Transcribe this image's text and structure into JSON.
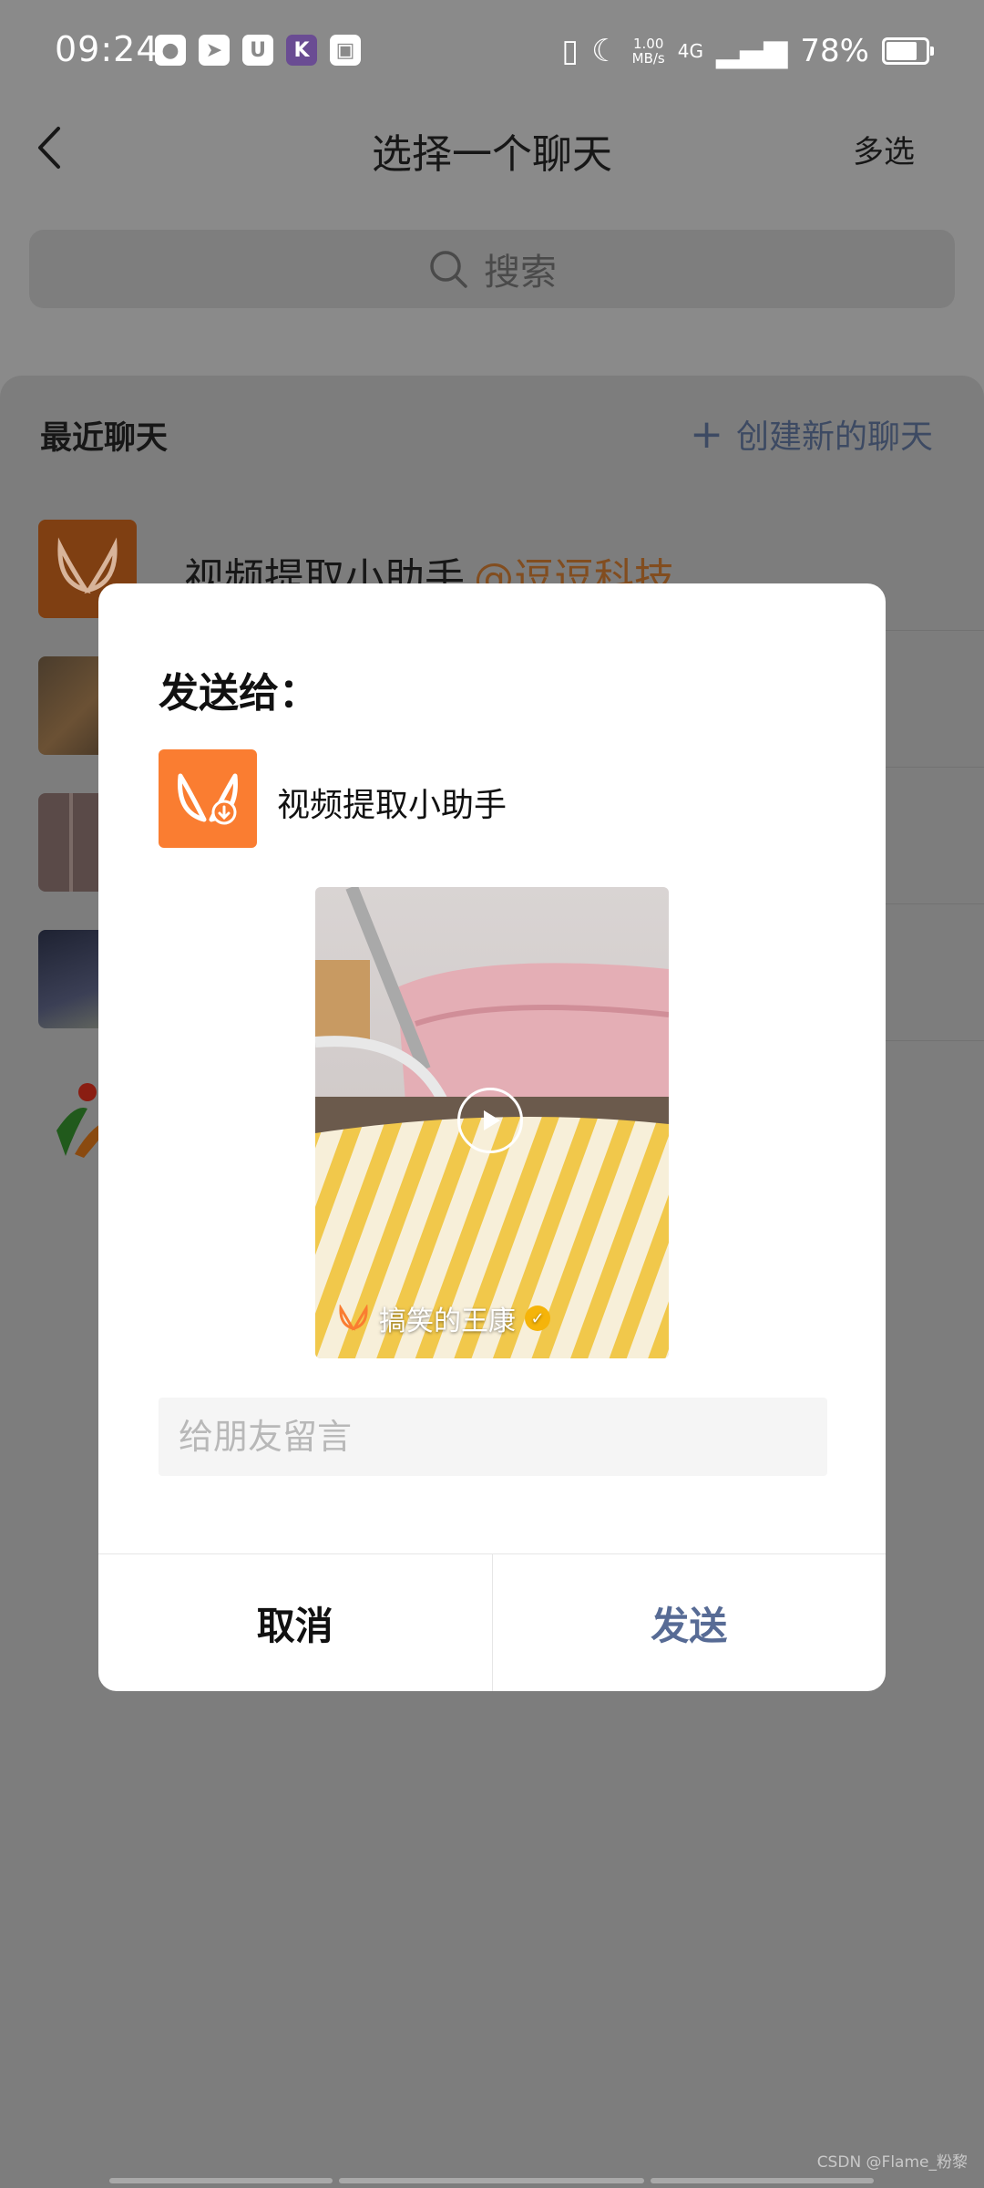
{
  "status_bar": {
    "time": "09:24",
    "app_icons": [
      "wechat-icon",
      "paper-plane-icon",
      "cup-icon",
      "k-icon",
      "inbox-icon"
    ],
    "network_speed_value": "1.00",
    "network_speed_unit": "MB/s",
    "signal_type": "4G",
    "battery": "78%"
  },
  "header": {
    "title": "选择一个聊天",
    "multi_select": "多选"
  },
  "search": {
    "placeholder": "搜索"
  },
  "recent": {
    "title": "最近聊天",
    "new_chat": "创建新的聊天",
    "items": [
      {
        "name": "视频提取小助手",
        "tag": "@逗逗科技"
      }
    ]
  },
  "dialog": {
    "title": "发送给：",
    "target_name": "视频提取小助手",
    "video_caption": "搞笑的王康",
    "message_placeholder": "给朋友留言",
    "cancel": "取消",
    "send": "发送"
  },
  "watermark": "CSDN @Flame_粉黎",
  "colors": {
    "brand_orange": "#fa7d31",
    "send_blue": "#576b95",
    "verified_gold": "#f5b40a"
  }
}
